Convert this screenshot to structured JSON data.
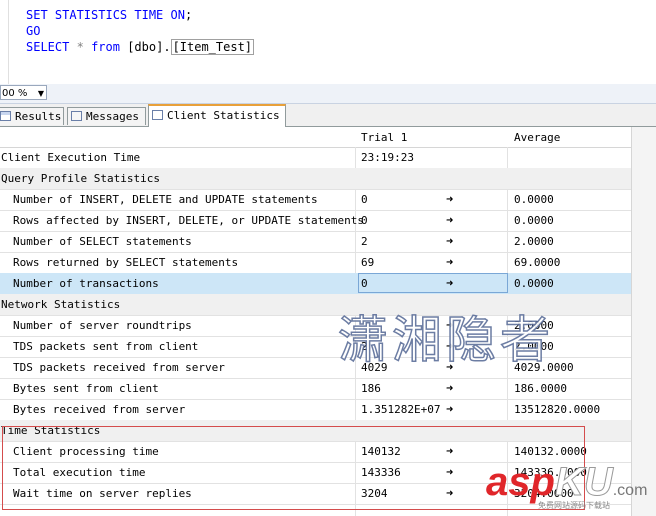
{
  "editor": {
    "line1": {
      "kw": "SET STATISTICS TIME ON",
      "punct": ";"
    },
    "line2": {
      "kw": "GO"
    },
    "line3": {
      "kw1": "SELECT",
      "op": "*",
      "kw2": "from",
      "schema": "[dbo].",
      "table": "[Item_Test]"
    }
  },
  "zoom": {
    "value": "00 %"
  },
  "tabs": [
    {
      "label": "Results",
      "icon": "grid-icon"
    },
    {
      "label": "Messages",
      "icon": "message-icon"
    },
    {
      "label": "Client Statistics",
      "icon": "statistics-icon"
    }
  ],
  "grid": {
    "headers": {
      "trial": "Trial  1",
      "average": "Average"
    },
    "arrow": "➜",
    "rows": [
      {
        "type": "data",
        "label": "Client Execution Time",
        "trial": "23:19:23",
        "avg": "",
        "arrow": false,
        "indent": false
      },
      {
        "type": "section",
        "label": "Query Profile Statistics"
      },
      {
        "type": "data",
        "label": "Number of INSERT, DELETE and UPDATE statements",
        "trial": "0",
        "avg": "0.0000",
        "arrow": true,
        "indent": true
      },
      {
        "type": "data",
        "label": "Rows affected by INSERT, DELETE, or UPDATE statements",
        "trial": "0",
        "avg": "0.0000",
        "arrow": true,
        "indent": true
      },
      {
        "type": "data",
        "label": "Number of SELECT statements",
        "trial": "2",
        "avg": "2.0000",
        "arrow": true,
        "indent": true
      },
      {
        "type": "data",
        "label": "Rows returned by SELECT statements",
        "trial": "69",
        "avg": "69.0000",
        "arrow": true,
        "indent": true
      },
      {
        "type": "selected",
        "label": "Number of transactions",
        "trial": "0",
        "avg": "0.0000",
        "arrow": true,
        "indent": true
      },
      {
        "type": "section",
        "label": "Network Statistics"
      },
      {
        "type": "data",
        "label": "Number of server roundtrips",
        "trial": "",
        "avg": "2.0000",
        "arrow": true,
        "indent": true
      },
      {
        "type": "data",
        "label": "TDS packets sent from client",
        "trial": "2",
        "avg": "2.0000",
        "arrow": true,
        "indent": true
      },
      {
        "type": "data",
        "label": "TDS packets received from server",
        "trial": "4029",
        "avg": "4029.0000",
        "arrow": true,
        "indent": true
      },
      {
        "type": "data",
        "label": "Bytes sent from client",
        "trial": "186",
        "avg": "186.0000",
        "arrow": true,
        "indent": true
      },
      {
        "type": "data",
        "label": "Bytes received from server",
        "trial": "1.351282E+07",
        "avg": "13512820.0000",
        "arrow": true,
        "indent": true
      },
      {
        "type": "section",
        "label": "Time Statistics"
      },
      {
        "type": "data",
        "label": "Client processing time",
        "trial": "140132",
        "avg": "140132.0000",
        "arrow": true,
        "indent": true
      },
      {
        "type": "data",
        "label": "Total execution time",
        "trial": "143336",
        "avg": "143336.0000",
        "arrow": true,
        "indent": true
      },
      {
        "type": "data",
        "label": "Wait time on server replies",
        "trial": "3204",
        "avg": "3204.0000",
        "arrow": true,
        "indent": true
      }
    ]
  },
  "watermark": {
    "chinese": "潇湘隐者",
    "logo_asp": "asp",
    "logo_ku": "KU",
    "logo_com": ".com",
    "logo_sub": "免费网站源码下载站"
  },
  "colors": {
    "keyword": "#0000ff",
    "selected_row": "#cde6f7",
    "section_row": "#f0f0f0",
    "highlight_box": "#d44c4c",
    "active_tab_accent": "#e8a03a"
  }
}
